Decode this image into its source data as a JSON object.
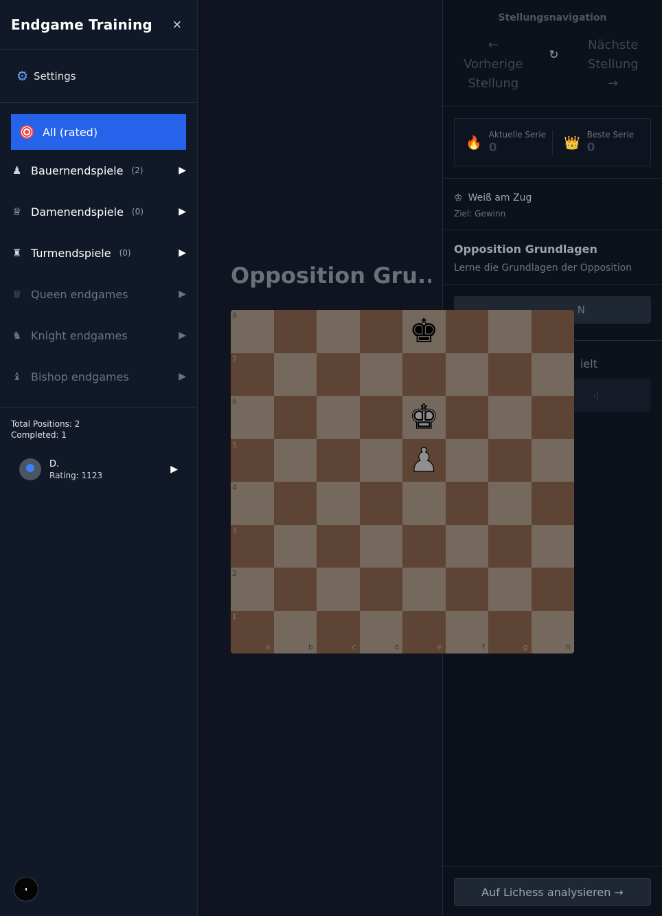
{
  "sidebar": {
    "title": "Endgame Training",
    "close_icon": "×",
    "settings_label": "Settings",
    "active_category": "All (rated)",
    "categories": [
      {
        "icon": "♟",
        "label": "Bauernendspiele",
        "count": "(2)",
        "arrow": "▶"
      },
      {
        "icon": "♕",
        "label": "Damenendspiele",
        "count": "(0)",
        "arrow": "▶"
      },
      {
        "icon": "♜",
        "label": "Turmendspiele",
        "count": "(0)",
        "arrow": "▶"
      },
      {
        "icon": "♕",
        "label": "Queen endgames",
        "count": "",
        "arrow": "▶"
      },
      {
        "icon": "♞",
        "label": "Knight endgames",
        "count": "",
        "arrow": "▶"
      },
      {
        "icon": "♝",
        "label": "Bishop endgames",
        "count": "",
        "arrow": "▶"
      }
    ],
    "stats": {
      "total": "Total Positions: 2",
      "completed": "Completed: 1"
    },
    "user": {
      "name": "D.",
      "rating": "Rating: 1123",
      "arrow": "▶"
    }
  },
  "main": {
    "title": "Opposition Gru...",
    "board": {
      "ranks": [
        "8",
        "7",
        "6",
        "5",
        "4",
        "3",
        "2",
        "1"
      ],
      "files": [
        "a",
        "b",
        "c",
        "d",
        "e",
        "f",
        "g",
        "h"
      ],
      "pieces": {
        "e8": "♚",
        "e6": "♚",
        "e5": "♟"
      }
    }
  },
  "panel": {
    "nav_title": "Stellungsnavigation",
    "prev_arrow": "←",
    "prev_line1": "Vorherige",
    "prev_line2": "Stellung",
    "reset_icon": "↻",
    "next_line1": "Nächste",
    "next_line2": "Stellung",
    "next_arrow": "→",
    "current_streak_label": "Aktuelle Serie",
    "current_streak_value": "0",
    "best_streak_label": "Beste Serie",
    "best_streak_value": "0",
    "turn_icon": "♔",
    "turn_text": "Weiß am Zug",
    "goal_text": "Ziel: Gewinn",
    "position_title": "Opposition Grundlagen",
    "position_desc": "Lerne die Grundlagen der Opposition",
    "button1_partial": "N",
    "played_partial": "ielt",
    "button2_icon": "›|",
    "lichess_button": "Auf Lichess analysieren →"
  },
  "colors": {
    "accent": "#2563eb",
    "light_square": "#75695d",
    "dark_square": "#5d4434"
  }
}
